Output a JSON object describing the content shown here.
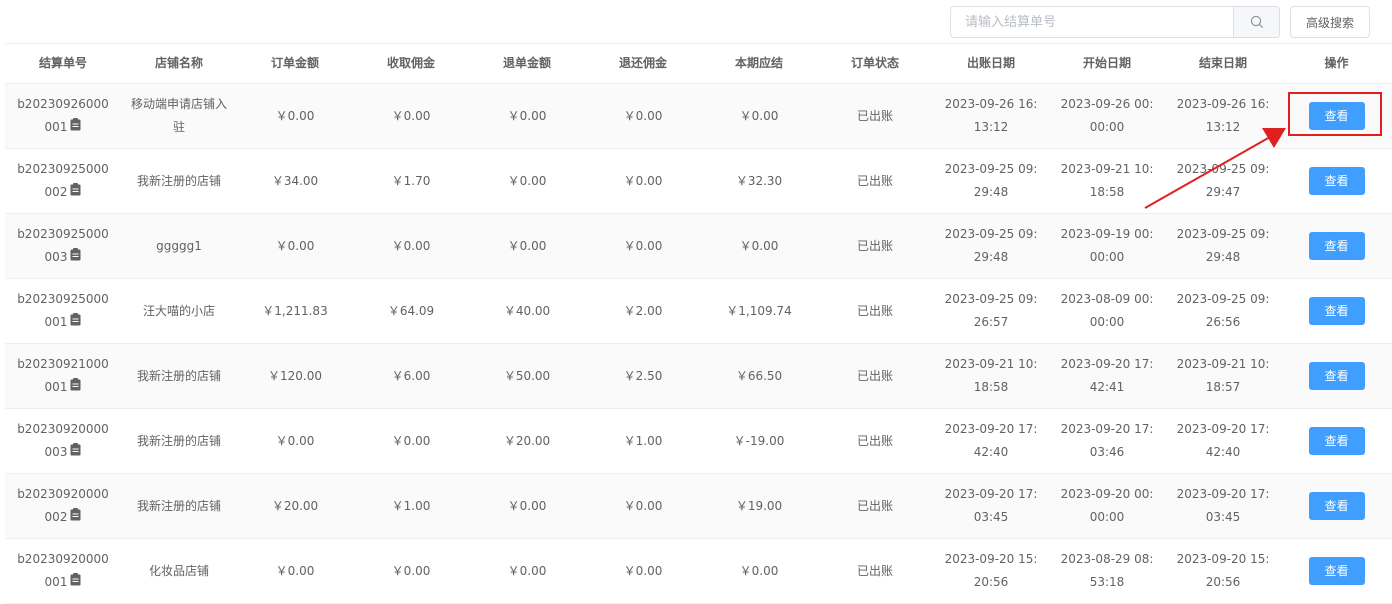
{
  "search": {
    "placeholder": "请输入结算单号",
    "value": ""
  },
  "advanced_search_label": "高级搜索",
  "columns": [
    "结算单号",
    "店铺名称",
    "订单金额",
    "收取佣金",
    "退单金额",
    "退还佣金",
    "本期应结",
    "订单状态",
    "出账日期",
    "开始日期",
    "结束日期",
    "操作"
  ],
  "rows": [
    {
      "settle_no": "b20230926000001",
      "store": "移动端申请店铺入驻",
      "order_amount": "￥0.00",
      "commission": "￥0.00",
      "refund_amount": "￥0.00",
      "refund_commission": "￥0.00",
      "payable": "￥0.00",
      "status": "已出账",
      "bill_date": "2023-09-26 16:13:12",
      "start_date": "2023-09-26 00:00:00",
      "end_date": "2023-09-26 16:13:12",
      "action": "查看"
    },
    {
      "settle_no": "b20230925000002",
      "store": "我新注册的店铺",
      "order_amount": "￥34.00",
      "commission": "￥1.70",
      "refund_amount": "￥0.00",
      "refund_commission": "￥0.00",
      "payable": "￥32.30",
      "status": "已出账",
      "bill_date": "2023-09-25 09:29:48",
      "start_date": "2023-09-21 10:18:58",
      "end_date": "2023-09-25 09:29:47",
      "action": "查看"
    },
    {
      "settle_no": "b20230925000003",
      "store": "ggggg1",
      "order_amount": "￥0.00",
      "commission": "￥0.00",
      "refund_amount": "￥0.00",
      "refund_commission": "￥0.00",
      "payable": "￥0.00",
      "status": "已出账",
      "bill_date": "2023-09-25 09:29:48",
      "start_date": "2023-09-19 00:00:00",
      "end_date": "2023-09-25 09:29:48",
      "action": "查看"
    },
    {
      "settle_no": "b20230925000001",
      "store": "汪大喵的小店",
      "order_amount": "￥1,211.83",
      "commission": "￥64.09",
      "refund_amount": "￥40.00",
      "refund_commission": "￥2.00",
      "payable": "￥1,109.74",
      "status": "已出账",
      "bill_date": "2023-09-25 09:26:57",
      "start_date": "2023-08-09 00:00:00",
      "end_date": "2023-09-25 09:26:56",
      "action": "查看"
    },
    {
      "settle_no": "b20230921000001",
      "store": "我新注册的店铺",
      "order_amount": "￥120.00",
      "commission": "￥6.00",
      "refund_amount": "￥50.00",
      "refund_commission": "￥2.50",
      "payable": "￥66.50",
      "status": "已出账",
      "bill_date": "2023-09-21 10:18:58",
      "start_date": "2023-09-20 17:42:41",
      "end_date": "2023-09-21 10:18:57",
      "action": "查看"
    },
    {
      "settle_no": "b20230920000003",
      "store": "我新注册的店铺",
      "order_amount": "￥0.00",
      "commission": "￥0.00",
      "refund_amount": "￥20.00",
      "refund_commission": "￥1.00",
      "payable": "￥-19.00",
      "status": "已出账",
      "bill_date": "2023-09-20 17:42:40",
      "start_date": "2023-09-20 17:03:46",
      "end_date": "2023-09-20 17:42:40",
      "action": "查看"
    },
    {
      "settle_no": "b20230920000002",
      "store": "我新注册的店铺",
      "order_amount": "￥20.00",
      "commission": "￥1.00",
      "refund_amount": "￥0.00",
      "refund_commission": "￥0.00",
      "payable": "￥19.00",
      "status": "已出账",
      "bill_date": "2023-09-20 17:03:45",
      "start_date": "2023-09-20 00:00:00",
      "end_date": "2023-09-20 17:03:45",
      "action": "查看"
    },
    {
      "settle_no": "b20230920000001",
      "store": "化妆品店铺",
      "order_amount": "￥0.00",
      "commission": "￥0.00",
      "refund_amount": "￥0.00",
      "refund_commission": "￥0.00",
      "payable": "￥0.00",
      "status": "已出账",
      "bill_date": "2023-09-20 15:20:56",
      "start_date": "2023-08-29 08:53:18",
      "end_date": "2023-09-20 15:20:56",
      "action": "查看"
    }
  ],
  "icons": {
    "search": "search-icon",
    "copy": "copy-icon"
  },
  "colors": {
    "primary": "#409eff",
    "highlight": "#e02020",
    "text": "#606266"
  }
}
